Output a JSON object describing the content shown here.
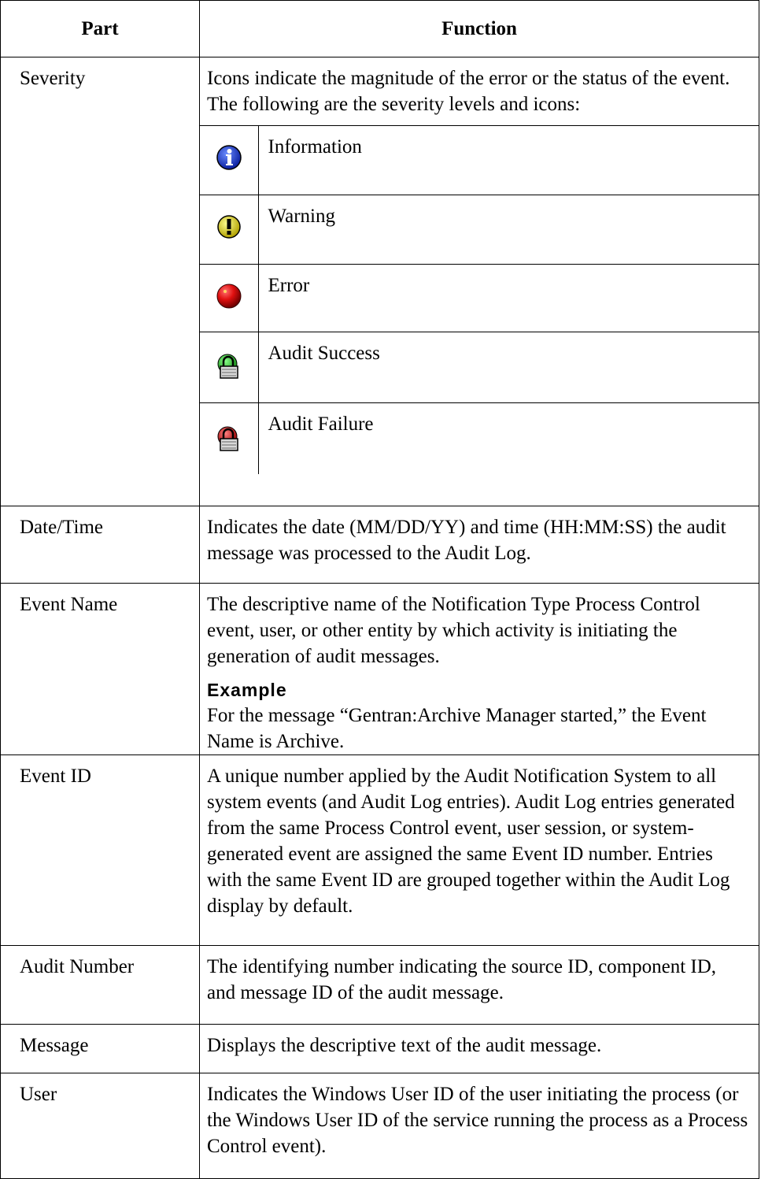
{
  "header": {
    "part": "Part",
    "function": "Function"
  },
  "severity": {
    "part": "Severity",
    "description": "Icons indicate the magnitude of the error or the status of the event. The following are the severity levels and icons:",
    "levels": [
      {
        "label": "Information",
        "icon": "information-icon",
        "color": "#1a3fd0"
      },
      {
        "label": "Warning",
        "icon": "warning-icon",
        "color": "#e8e000"
      },
      {
        "label": "Error",
        "icon": "error-icon",
        "color": "#e01010"
      },
      {
        "label": "Audit Success",
        "icon": "audit-success-lock-icon",
        "color": "#2fc82f"
      },
      {
        "label": "Audit Failure",
        "icon": "audit-failure-lock-icon",
        "color": "#e01010"
      }
    ]
  },
  "rows": [
    {
      "part": "Date/Time",
      "function": "Indicates the date (MM/DD/YY) and time (HH:MM:SS) the audit message was processed to the Audit Log."
    },
    {
      "part": "Event Name",
      "function": "The descriptive name of the Notification Type Process Control event, user, or other entity by which activity is initiating the generation of audit messages.",
      "example_title": "Example",
      "example_text": "For the message “Gentran:Archive Manager started,” the Event Name is Archive."
    },
    {
      "part": "Event ID",
      "function": "A unique number applied by the Audit Notification System to all system events (and Audit Log entries). Audit Log entries generated from the same Process Control event, user session, or system-generated event are assigned the same Event ID number. Entries with the same Event ID are grouped together within the Audit Log display by default."
    },
    {
      "part": "Audit Number",
      "function": "The identifying number indicating the source ID, component ID, and message ID of the audit message."
    },
    {
      "part": "Message",
      "function": "Displays the descriptive text of the audit message."
    },
    {
      "part": "User",
      "function": "Indicates the Windows User ID of the user initiating the process (or the Windows User ID of the service running the process as a Process Control event)."
    }
  ]
}
